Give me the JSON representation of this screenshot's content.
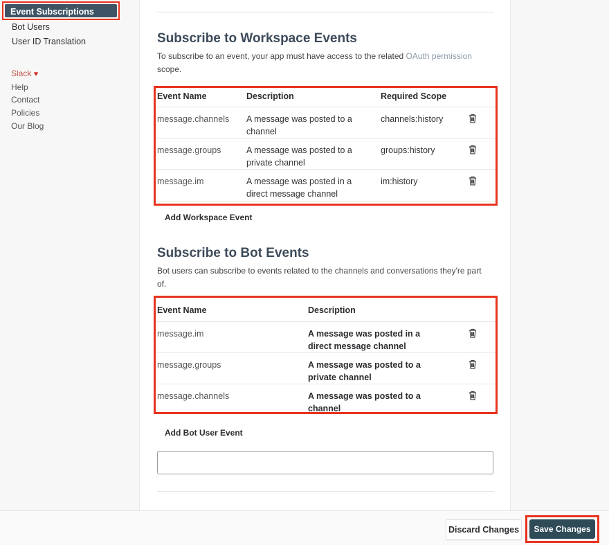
{
  "sidebar": {
    "active_item": "Event Subscriptions",
    "items": [
      "Bot Users",
      "User ID Translation"
    ],
    "slack_label": "Slack",
    "links": [
      "Help",
      "Contact",
      "Policies",
      "Our Blog"
    ]
  },
  "workspace_events": {
    "title": "Subscribe to Workspace Events",
    "description_prefix": "To subscribe to an event, your app must have access to the related ",
    "description_link": "OAuth permission",
    "description_suffix": "scope.",
    "headers": {
      "name": "Event Name",
      "description": "Description",
      "scope": "Required Scope"
    },
    "rows": [
      {
        "name": "message.channels",
        "desc1": "A message was posted to a",
        "desc2": "channel",
        "scope": "channels:history"
      },
      {
        "name": "message.groups",
        "desc1": "A message was posted to a",
        "desc2": "private channel",
        "scope": "groups:history"
      },
      {
        "name": "message.im",
        "desc1": "A message was posted in a",
        "desc2": "direct message channel",
        "scope": "im:history"
      }
    ],
    "add_label": "Add Workspace Event"
  },
  "bot_events": {
    "title": "Subscribe to Bot Events",
    "description_line1": "Bot users can subscribe to events related to the channels and conversations they're part",
    "description_line2": "of.",
    "headers": {
      "name": "Event Name",
      "description": "Description"
    },
    "rows": [
      {
        "name": "message.im",
        "desc1": "A message was posted in a",
        "desc2": "direct message channel"
      },
      {
        "name": "message.groups",
        "desc1": "A message was posted to a",
        "desc2": "private channel"
      },
      {
        "name": "message.channels",
        "desc1": "A message was posted to a",
        "desc2": "channel"
      }
    ],
    "add_label": "Add Bot User Event",
    "input_value": ""
  },
  "footer": {
    "discard_label": "Discard Changes",
    "save_label": "Save Changes"
  },
  "colors": {
    "highlight": "#e8331f",
    "active_nav": "#3e5465",
    "save_button": "#2f4b58",
    "heading": "#3d4b5a"
  },
  "icons": {
    "delete": "trash-icon",
    "love": "heart-icon"
  }
}
